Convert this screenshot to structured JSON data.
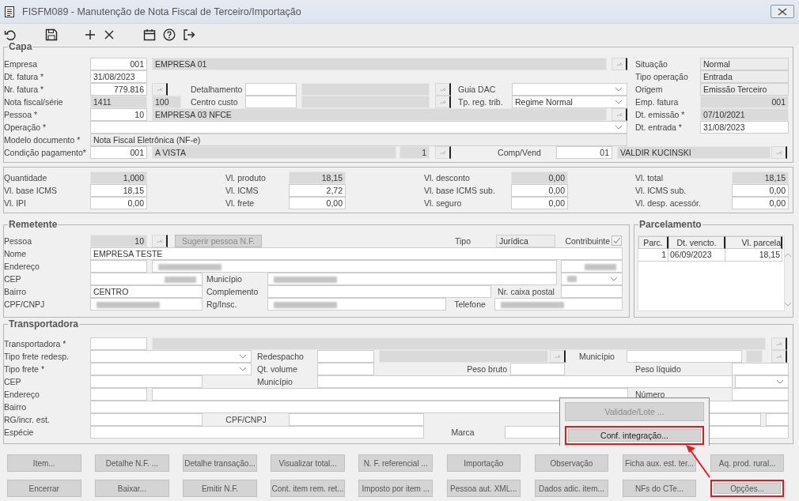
{
  "window": {
    "title": "FISFM089 - Manutenção de Nota Fiscal de Terceiro/Importação"
  },
  "capa": {
    "legend": "Capa",
    "lines": [
      [
        {
          "label": "Empresa",
          "controls": [
            {
              "kind": "field",
              "value": "001",
              "readonly": false
            },
            {
              "kind": "field",
              "value": "EMPRESA 01",
              "readonly": true
            },
            {
              "kind": "lookup"
            }
          ]
        },
        {
          "label": "Situação",
          "controls": [
            {
              "kind": "display",
              "value": "Normal"
            }
          ]
        }
      ],
      [
        {
          "label": "Dt. fatura *",
          "controls": [
            {
              "kind": "field",
              "value": "31/08/2023",
              "readonly": false
            }
          ]
        },
        {
          "label": "Tipo operação",
          "controls": [
            {
              "kind": "display",
              "value": "Entrada"
            }
          ]
        }
      ],
      [
        {
          "label": "Nr. fatura *",
          "controls": [
            {
              "kind": "field",
              "value": "779.816",
              "readonly": false
            },
            {
              "kind": "lookup"
            }
          ]
        },
        {
          "label": "Detalhamento",
          "controls": [
            {
              "kind": "field",
              "readonly": false
            },
            {
              "kind": "field",
              "readonly": true
            },
            {
              "kind": "lookup"
            }
          ]
        },
        {
          "label": "Guia DAC",
          "controls": [
            {
              "kind": "select"
            }
          ]
        },
        {
          "label": "Origem",
          "controls": [
            {
              "kind": "display",
              "value": "Emissão Terceiro"
            }
          ]
        }
      ],
      [
        {
          "label": "Nota fiscal/série",
          "controls": [
            {
              "kind": "field",
              "value": "1411",
              "readonly": true
            },
            {
              "kind": "field",
              "value": "100",
              "readonly": true
            }
          ]
        },
        {
          "label": "Centro custo",
          "controls": [
            {
              "kind": "field",
              "readonly": false
            },
            {
              "kind": "field",
              "readonly": true
            },
            {
              "kind": "lookup"
            }
          ]
        },
        {
          "label": "Tp. reg. trib.",
          "controls": [
            {
              "kind": "select",
              "value": "Regime Normal"
            }
          ]
        },
        {
          "label": "Emp. fatura",
          "controls": [
            {
              "kind": "field",
              "value": "001",
              "readonly": true
            }
          ]
        }
      ],
      [
        {
          "label": "Pessoa *",
          "controls": [
            {
              "kind": "field",
              "value": "10",
              "readonly": false
            },
            {
              "kind": "field",
              "value": "EMPRESA 03 NFCE",
              "readonly": true
            },
            {
              "kind": "lookup"
            }
          ]
        },
        {
          "label": "Dt. emissão *",
          "controls": [
            {
              "kind": "field",
              "value": "07/10/2021",
              "readonly": true
            }
          ]
        }
      ],
      [
        {
          "label": "Operação *",
          "controls": [
            {
              "kind": "select"
            }
          ]
        },
        {
          "label": "Dt. entrada *",
          "controls": [
            {
              "kind": "field",
              "value": "31/08/2023",
              "readonly": false
            }
          ]
        }
      ],
      [
        {
          "label": "Modelo documento *",
          "controls": [
            {
              "kind": "display",
              "value": "Nota Fiscal Eletrônica (NF-e)"
            }
          ]
        }
      ],
      [
        {
          "label": "Condição pagamento*",
          "controls": [
            {
              "kind": "field",
              "value": "001",
              "readonly": false
            },
            {
              "kind": "field",
              "value": "A VISTA",
              "readonly": true
            },
            {
              "kind": "field",
              "value": "1",
              "readonly": true
            },
            {
              "kind": "lookup"
            }
          ]
        },
        {
          "label": "Comp/Vend",
          "controls": [
            {
              "kind": "field",
              "value": "01",
              "readonly": false
            },
            {
              "kind": "field",
              "value": "VALDIR KUCINSKI",
              "readonly": true
            },
            {
              "kind": "lookup"
            }
          ]
        }
      ]
    ]
  },
  "totais": {
    "lines": [
      [
        {
          "label": "Quantidade",
          "controls": [
            {
              "kind": "field",
              "value": "1,000",
              "readonly": true
            }
          ]
        },
        {
          "label": "Vl. produto",
          "controls": [
            {
              "kind": "field",
              "value": "18,15",
              "readonly": true
            }
          ]
        },
        {
          "label": "Vl. desconto",
          "controls": [
            {
              "kind": "field",
              "value": "0,00",
              "readonly": true
            }
          ]
        },
        {
          "label": "Vl. total",
          "controls": [
            {
              "kind": "field",
              "value": "18,15",
              "readonly": true
            }
          ]
        }
      ],
      [
        {
          "label": "Vl. base ICMS",
          "controls": [
            {
              "kind": "field",
              "value": "18,15",
              "readonly": false
            }
          ]
        },
        {
          "label": "Vl. ICMS",
          "controls": [
            {
              "kind": "field",
              "value": "2,72",
              "readonly": false
            }
          ]
        },
        {
          "label": "Vl. base ICMS sub.",
          "controls": [
            {
              "kind": "field",
              "value": "0,00",
              "readonly": false
            }
          ]
        },
        {
          "label": "Vl. ICMS sub.",
          "controls": [
            {
              "kind": "field",
              "value": "0,00",
              "readonly": false
            }
          ]
        }
      ],
      [
        {
          "label": "Vl. IPI",
          "controls": [
            {
              "kind": "field",
              "value": "0,00",
              "readonly": false
            }
          ]
        },
        {
          "label": "Vl. frete",
          "controls": [
            {
              "kind": "field",
              "value": "0,00",
              "readonly": false
            }
          ]
        },
        {
          "label": "Vl. seguro",
          "controls": [
            {
              "kind": "field",
              "value": "0,00",
              "readonly": false
            }
          ]
        },
        {
          "label": "Vl. desp. acessór.",
          "controls": [
            {
              "kind": "field",
              "value": "0,00",
              "readonly": false
            }
          ]
        }
      ]
    ]
  },
  "remetente": {
    "legend": "Remetente",
    "lines": [
      [
        {
          "label": "Pessoa",
          "controls": [
            {
              "kind": "field",
              "value": "10",
              "readonly": true
            },
            {
              "kind": "lookup"
            },
            {
              "kind": "button",
              "label": "Sugerir pessoa N.F.",
              "disabled": true
            }
          ]
        },
        {
          "label": "Tipo",
          "controls": [
            {
              "kind": "display",
              "value": "Jurídica"
            }
          ]
        },
        {
          "label": "Contribuinte",
          "controls": [
            {
              "kind": "check",
              "checked": true
            }
          ]
        }
      ],
      [
        {
          "label": "Nome",
          "controls": [
            {
              "kind": "field",
              "value": "EMPRESA TESTE",
              "readonly": false
            }
          ]
        }
      ],
      [
        {
          "label": "Endereço",
          "controls": [
            {
              "kind": "field",
              "readonly": false
            },
            {
              "kind": "field",
              "readonly": false,
              "redacted": true
            },
            {
              "kind": "field",
              "readonly": false,
              "redacted": true
            }
          ]
        }
      ],
      [
        {
          "label": "CEP",
          "controls": [
            {
              "kind": "field",
              "readonly": false,
              "redacted": true
            }
          ]
        },
        {
          "label": "Município",
          "controls": [
            {
              "kind": "field",
              "readonly": false,
              "redacted": true
            },
            {
              "kind": "select",
              "redacted": true
            }
          ]
        }
      ],
      [
        {
          "label": "Bairro",
          "controls": [
            {
              "kind": "field",
              "value": "CENTRO",
              "readonly": false
            }
          ]
        },
        {
          "label": "Complemento",
          "controls": [
            {
              "kind": "field",
              "readonly": false
            }
          ]
        },
        {
          "label": "Nr. caixa postal",
          "controls": [
            {
              "kind": "field",
              "readonly": false
            }
          ]
        }
      ],
      [
        {
          "label": "CPF/CNPJ",
          "controls": [
            {
              "kind": "field",
              "readonly": false,
              "redacted": true
            }
          ]
        },
        {
          "label": "Rg/Insc.",
          "controls": [
            {
              "kind": "field",
              "readonly": false,
              "redacted": true
            }
          ]
        },
        {
          "label": "Telefone",
          "controls": [
            {
              "kind": "field",
              "readonly": false,
              "redacted": true
            }
          ]
        }
      ]
    ]
  },
  "parcelamento": {
    "legend": "Parcelamento",
    "columns": [
      "Parc.",
      "Dt. vencto.",
      "Vl. parcela"
    ],
    "rows": [
      [
        "1",
        "06/09/2023",
        "18,15"
      ]
    ]
  },
  "transportadora": {
    "legend": "Transportadora",
    "lines": [
      [
        {
          "label": "Transportadora *",
          "controls": [
            {
              "kind": "field",
              "readonly": false
            },
            {
              "kind": "field",
              "readonly": true
            },
            {
              "kind": "lookup"
            }
          ]
        }
      ],
      [
        {
          "label": "Tipo frete redesp.",
          "controls": [
            {
              "kind": "select"
            }
          ]
        },
        {
          "label": "Redespacho",
          "controls": [
            {
              "kind": "field",
              "readonly": false
            },
            {
              "kind": "field",
              "readonly": true
            },
            {
              "kind": "lookup"
            }
          ]
        },
        {
          "label": "Município",
          "controls": [
            {
              "kind": "field",
              "readonly": false
            },
            {
              "kind": "field",
              "readonly": true
            },
            {
              "kind": "lookup"
            }
          ]
        }
      ],
      [
        {
          "label": "Tipo frete *",
          "controls": [
            {
              "kind": "select"
            }
          ]
        },
        {
          "label": "Qt. volume",
          "controls": [
            {
              "kind": "field",
              "readonly": false
            }
          ]
        },
        {
          "label": "Peso bruto",
          "controls": [
            {
              "kind": "field",
              "readonly": false
            }
          ]
        },
        {
          "label": "Peso líquido",
          "controls": [
            {
              "kind": "field",
              "readonly": false
            }
          ]
        }
      ],
      [
        {
          "label": "CEP",
          "controls": [
            {
              "kind": "field",
              "readonly": false
            }
          ]
        },
        {
          "label": "Município",
          "controls": [
            {
              "kind": "field",
              "readonly": false
            },
            {
              "kind": "select"
            }
          ]
        }
      ],
      [
        {
          "label": "Endereço",
          "controls": [
            {
              "kind": "field",
              "readonly": false
            },
            {
              "kind": "field",
              "readonly": false
            }
          ]
        },
        {
          "label": "Número",
          "controls": [
            {
              "kind": "field",
              "readonly": false
            }
          ]
        }
      ],
      [
        {
          "label": "Bairro",
          "controls": [
            {
              "kind": "field",
              "readonly": false
            }
          ]
        }
      ],
      [
        {
          "label": "RG/incr. est.",
          "controls": [
            {
              "kind": "field",
              "readonly": false
            }
          ]
        },
        {
          "label": "CPF/CNPJ",
          "controls": [
            {
              "kind": "field",
              "readonly": false
            },
            {
              "kind": "field",
              "readonly": false
            },
            {
              "kind": "field",
              "readonly": false
            }
          ]
        }
      ],
      [
        {
          "label": "Espécie",
          "controls": [
            {
              "kind": "field",
              "readonly": false
            }
          ]
        },
        {
          "label": "Marca",
          "controls": [
            {
              "kind": "field",
              "readonly": false
            }
          ]
        }
      ]
    ]
  },
  "popup": {
    "items": [
      {
        "label": "Validade/Lote ...",
        "disabled": true,
        "highlighted": false
      },
      {
        "label": "Conf. integração...",
        "disabled": false,
        "highlighted": true
      }
    ]
  },
  "buttons": [
    [
      {
        "label": "Item...",
        "highlighted": false
      },
      {
        "label": "Detalhe N.F. ...",
        "highlighted": false
      },
      {
        "label": "Detalhe transação...",
        "highlighted": false
      },
      {
        "label": "Visualizar total...",
        "highlighted": false
      },
      {
        "label": "N. F. referencial ...",
        "highlighted": false
      },
      {
        "label": "Importação",
        "highlighted": false
      },
      {
        "label": "Observação",
        "highlighted": false
      },
      {
        "label": "Ficha aux. est. ter...",
        "highlighted": false
      },
      {
        "label": "Aq. prod. rural...",
        "highlighted": false
      }
    ],
    [
      {
        "label": "Encerrar",
        "highlighted": false
      },
      {
        "label": "Baixar...",
        "highlighted": false
      },
      {
        "label": "Emitir N.F.",
        "highlighted": false
      },
      {
        "label": "Cont. item rem. ret...",
        "highlighted": false
      },
      {
        "label": "Imposto por item ...",
        "highlighted": false
      },
      {
        "label": "Pessoa aut. XML...",
        "highlighted": false
      },
      {
        "label": "Dados adic. item...",
        "highlighted": false
      },
      {
        "label": "NFs do CTe...",
        "highlighted": false
      },
      {
        "label": "Opções...",
        "highlighted": true
      }
    ]
  ]
}
